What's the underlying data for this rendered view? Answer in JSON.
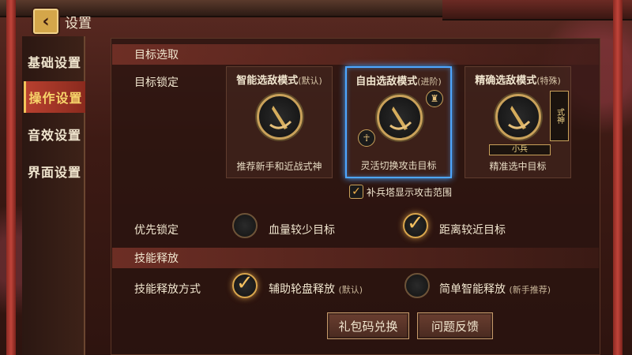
{
  "header": {
    "title": "设置"
  },
  "sidebar": {
    "items": [
      {
        "label": "基础设置",
        "active": false
      },
      {
        "label": "操作设置",
        "active": true
      },
      {
        "label": "音效设置",
        "active": false
      },
      {
        "label": "界面设置",
        "active": false
      }
    ]
  },
  "target_section": {
    "heading": "目标选取",
    "lock_label": "目标锁定",
    "modes": [
      {
        "name": "智能选敌模式",
        "tag": "(默认)",
        "desc": "推荐新手和近战式神",
        "selected": false
      },
      {
        "name": "自由选敌模式",
        "tag": "(进阶)",
        "desc": "灵活切换攻击目标",
        "selected": true
      },
      {
        "name": "精确选敌模式",
        "tag": "(特殊)",
        "desc": "精准选中目标",
        "selected": false
      }
    ],
    "shishen_tag": "式神",
    "soldier_tag": "小兵",
    "tower_range_option": {
      "label": "补兵塔显示攻击范围",
      "checked": true
    }
  },
  "priority": {
    "label": "优先锁定",
    "options": [
      {
        "label": "血量较少目标",
        "checked": false
      },
      {
        "label": "距离较近目标",
        "checked": true
      }
    ]
  },
  "skill_section": {
    "heading": "技能释放",
    "method_label": "技能释放方式",
    "options": [
      {
        "label": "辅助轮盘释放",
        "tag": "(默认)",
        "checked": true
      },
      {
        "label": "简单智能释放",
        "tag": "(新手推荐)",
        "checked": false
      }
    ]
  },
  "buttons": {
    "gift_code": "礼包码兑换",
    "feedback": "问题反馈"
  },
  "colors": {
    "selected_border": "#4da6ff",
    "accent_gold": "#f3c35a",
    "active_tab": "#b8402f"
  }
}
